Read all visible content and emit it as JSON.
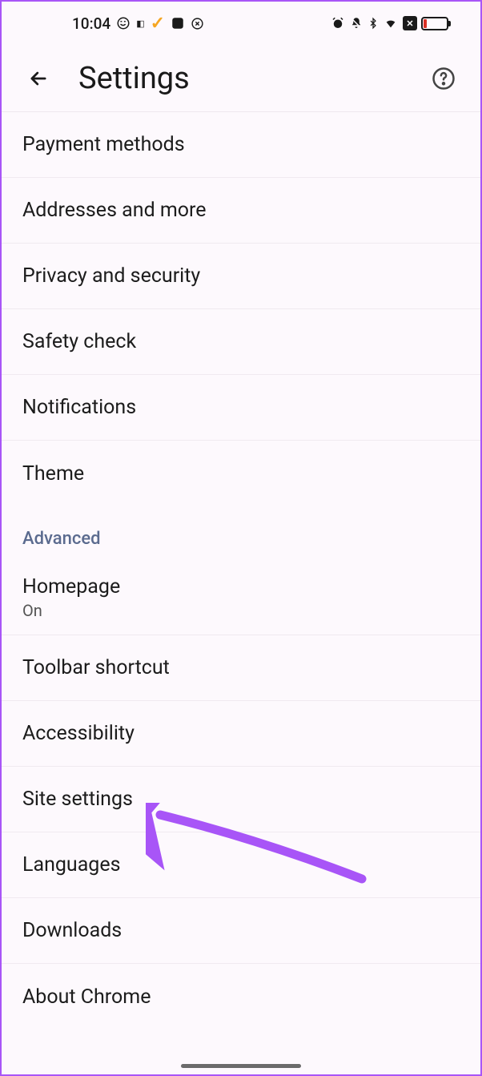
{
  "status": {
    "time": "10:04"
  },
  "header": {
    "title": "Settings"
  },
  "section": {
    "advanced": "Advanced"
  },
  "items": {
    "payment": "Payment methods",
    "addresses": "Addresses and more",
    "privacy": "Privacy and security",
    "safety": "Safety check",
    "notifications": "Notifications",
    "theme": "Theme",
    "homepage": "Homepage",
    "homepage_sub": "On",
    "toolbar": "Toolbar shortcut",
    "accessibility": "Accessibility",
    "site": "Site settings",
    "languages": "Languages",
    "downloads": "Downloads",
    "about": "About Chrome"
  },
  "annotation": {
    "color": "#a855f7"
  }
}
